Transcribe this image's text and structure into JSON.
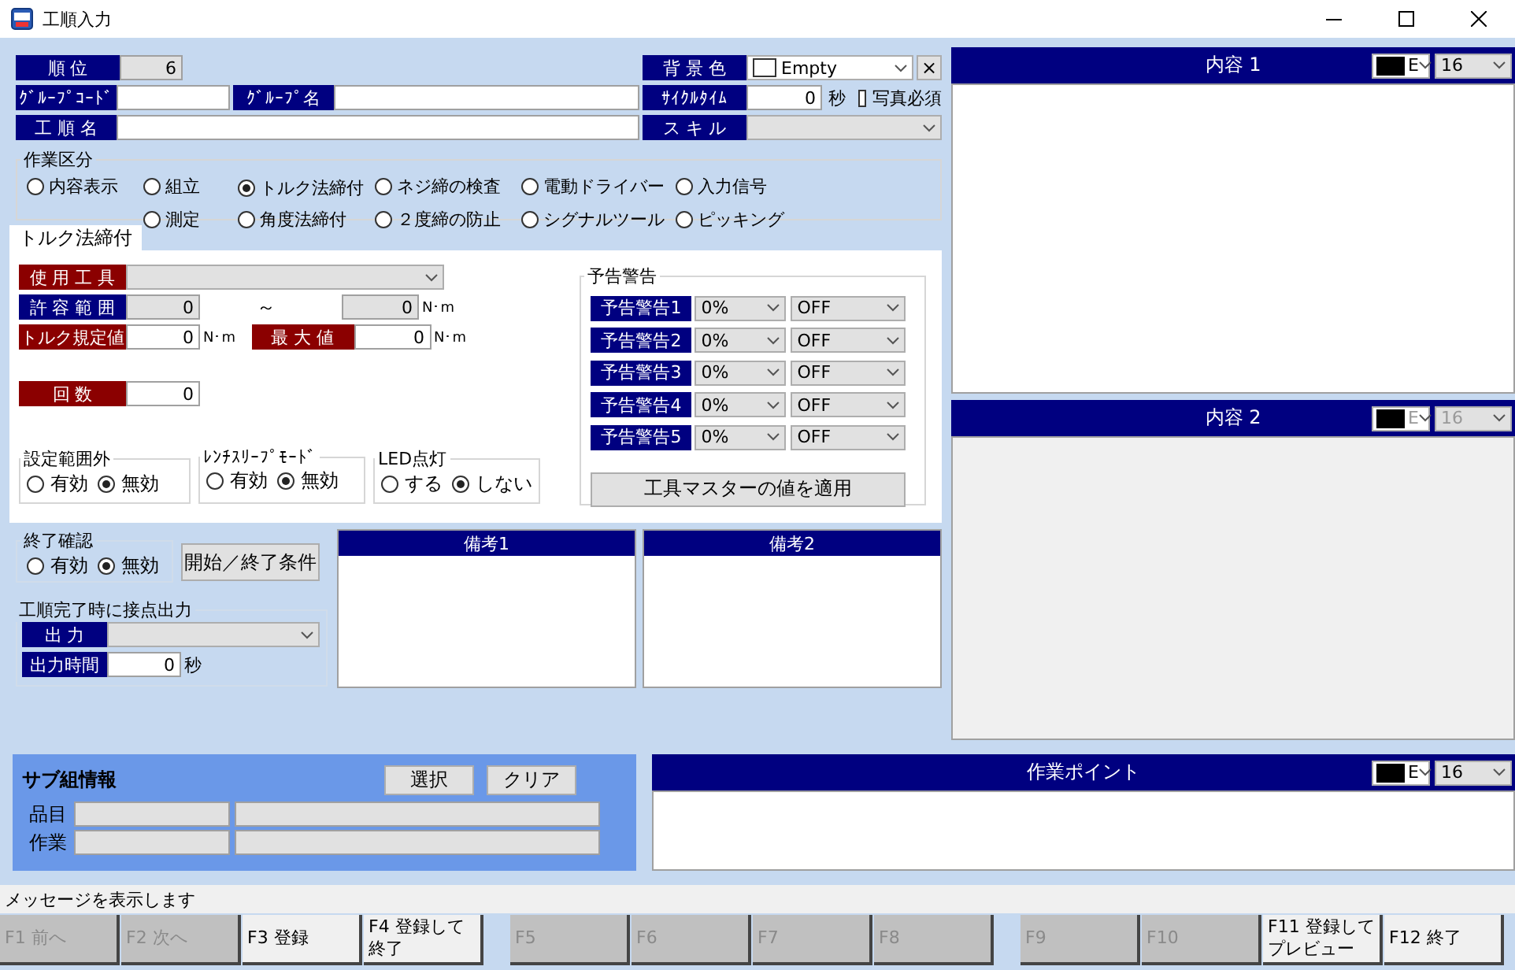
{
  "window": {
    "title": "工順入力"
  },
  "header": {
    "order": {
      "label": "順 位",
      "value": "6"
    },
    "background_color": {
      "label": "背 景 色",
      "value": "Empty"
    },
    "clear_button": "×",
    "group_code": {
      "label": "ｸﾞﾙｰﾌﾟｺｰﾄﾞ"
    },
    "group_name": {
      "label": "ｸﾞﾙｰﾌﾟ名"
    },
    "cycle_time": {
      "label": "ｻｲｸﾙﾀｲﾑ",
      "value": "0",
      "unit": "秒"
    },
    "photo_required": {
      "label": "写真必須",
      "checked": false
    },
    "process_name": {
      "label": "工 順 名"
    },
    "skill": {
      "label": "ス キ ル",
      "disabled": true
    }
  },
  "work_type": {
    "title": "作業区分",
    "rows": [
      [
        {
          "label": "内容表示",
          "selected": false
        },
        {
          "label": "組立",
          "selected": false
        },
        {
          "label": "トルク法締付",
          "selected": true
        },
        {
          "label": "ネジ締の検査",
          "selected": false
        },
        {
          "label": "電動ドライバー",
          "selected": false
        },
        {
          "label": "入力信号",
          "selected": false
        }
      ],
      [
        "",
        {
          "label": "測定",
          "selected": false
        },
        {
          "label": "角度法締付",
          "selected": false
        },
        {
          "label": "２度締の防止",
          "selected": false
        },
        {
          "label": "シグナルツール",
          "selected": false
        },
        {
          "label": "ピッキング",
          "selected": false
        }
      ]
    ]
  },
  "tabs": [
    {
      "label": "トルク法締付",
      "selected": true
    }
  ],
  "torque": {
    "tool": {
      "label": "使 用 工 具",
      "color": "#8b0000"
    },
    "tolerance": {
      "label": "許 容 範 囲",
      "color": "#000080",
      "min": "0",
      "separator": "～",
      "max": "0",
      "unit": "N･m"
    },
    "torque_spec": {
      "label": "トルク規定値",
      "color": "#8b0000",
      "value": "0",
      "unit": "N･m"
    },
    "max_value": {
      "label": "最 大 値",
      "color": "#8b0000",
      "value": "0",
      "unit": "N･m"
    },
    "count": {
      "label": "回 数",
      "color": "#8b0000",
      "value": "0"
    },
    "option_groups": [
      {
        "title": "設定範囲外",
        "options": [
          {
            "label": "有効",
            "selected": false
          },
          {
            "label": "無効",
            "selected": true
          }
        ]
      },
      {
        "title": "ﾚﾝﾁｽﾘｰﾌﾟﾓｰﾄﾞ",
        "options": [
          {
            "label": "有効",
            "selected": false
          },
          {
            "label": "無効",
            "selected": true
          }
        ]
      },
      {
        "title": "LED点灯",
        "options": [
          {
            "label": "する",
            "selected": false
          },
          {
            "label": "しない",
            "selected": true
          }
        ]
      }
    ],
    "warnings": {
      "title": "予告警告",
      "rows": [
        {
          "label": "予告警告1",
          "percent": "0%",
          "mode": "OFF"
        },
        {
          "label": "予告警告2",
          "percent": "0%",
          "mode": "OFF"
        },
        {
          "label": "予告警告3",
          "percent": "0%",
          "mode": "OFF"
        },
        {
          "label": "予告警告4",
          "percent": "0%",
          "mode": "OFF"
        },
        {
          "label": "予告警告5",
          "percent": "0%",
          "mode": "OFF"
        }
      ],
      "apply_button": "工具マスターの値を適用"
    }
  },
  "end_confirm": {
    "title": "終了確認",
    "options": [
      {
        "label": "有効",
        "selected": false
      },
      {
        "label": "無効",
        "selected": true
      }
    ]
  },
  "start_end_button": "開始／終了条件",
  "contact_output": {
    "title": "工順完了時に接点出力",
    "output": {
      "label": "出 力"
    },
    "time": {
      "label": "出力時間",
      "value": "0",
      "unit": "秒"
    }
  },
  "remarks": [
    {
      "title": "備考1"
    },
    {
      "title": "備考2"
    }
  ],
  "content_panels": [
    {
      "title": "内容 1",
      "color_text": "E",
      "font_size": "16",
      "disabled": false
    },
    {
      "title": "内容 2",
      "color_text": "E",
      "font_size": "16",
      "disabled": true
    }
  ],
  "sub_assembly": {
    "title": "サブ組情報",
    "buttons": [
      "選択",
      "クリア"
    ],
    "rows": [
      {
        "label": "品目"
      },
      {
        "label": "作業"
      }
    ]
  },
  "work_point": {
    "title": "作業ポイント",
    "color_text": "E",
    "font_size": "16",
    "disabled": false
  },
  "status_bar": {
    "message": "メッセージを表示します"
  },
  "function_keys": [
    {
      "label": "F1 前へ",
      "disabled": true
    },
    {
      "label": "F2 次へ",
      "disabled": true
    },
    {
      "label": "F3 登録",
      "disabled": false
    },
    {
      "label": "F4 登録して終了",
      "disabled": false
    },
    {
      "label": "F5",
      "disabled": true
    },
    {
      "label": "F6",
      "disabled": true
    },
    {
      "label": "F7",
      "disabled": true
    },
    {
      "label": "F8",
      "disabled": true
    },
    {
      "label": "F9",
      "disabled": true
    },
    {
      "label": "F10",
      "disabled": true
    },
    {
      "label": "F11 登録してプレビュー",
      "disabled": false
    },
    {
      "label": "F12 終了",
      "disabled": false
    }
  ]
}
